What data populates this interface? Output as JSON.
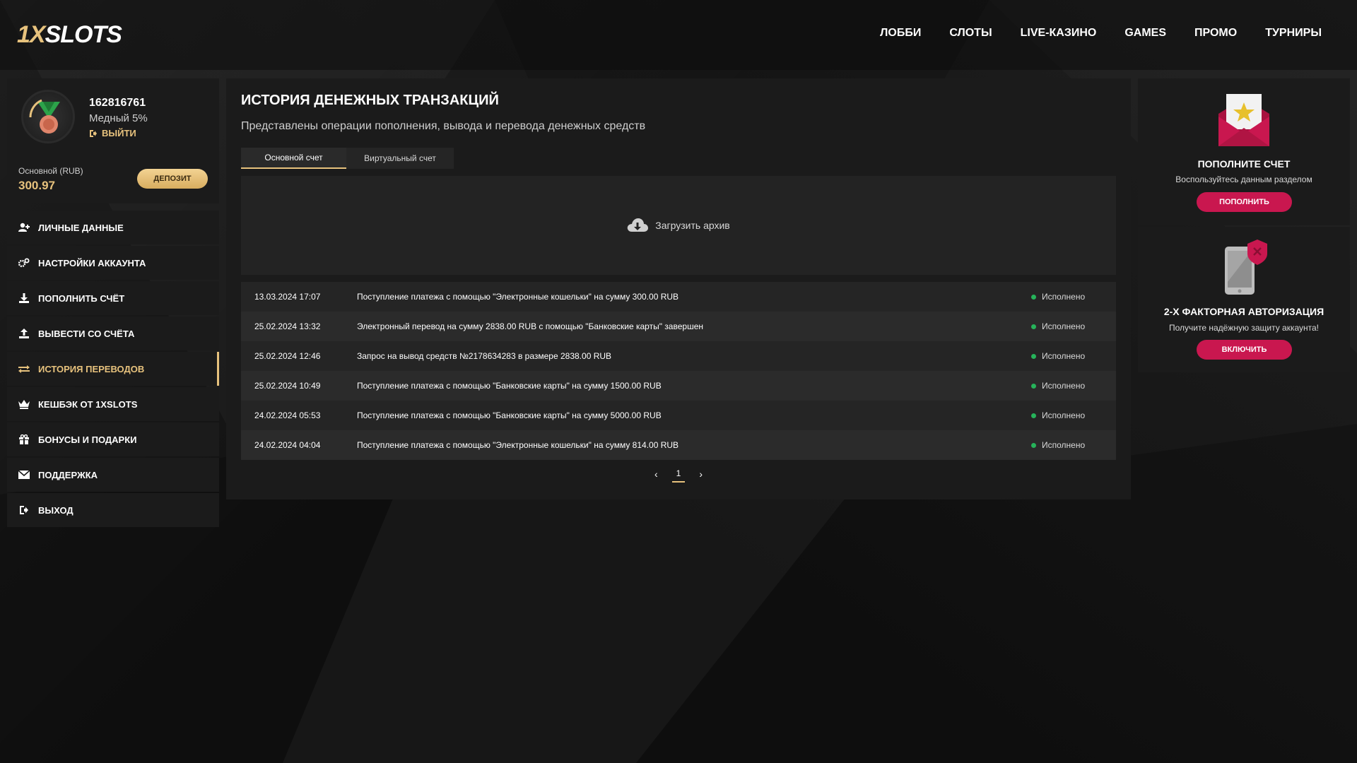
{
  "header": {
    "logo_one": "1X",
    "logo_rest": "SLOTS",
    "nav": [
      "ЛОББИ",
      "СЛОТЫ",
      "LIVE-КАЗИНО",
      "GAMES",
      "ПРОМО",
      "ТУРНИРЫ"
    ]
  },
  "user": {
    "id": "162816761",
    "level": "Медный 5%",
    "logout": "ВЫЙТИ",
    "account_label": "Основной (RUB)",
    "balance": "300.97",
    "deposit_label": "ДЕПОЗИТ"
  },
  "menu": [
    {
      "label": "ЛИЧНЫЕ ДАННЫЕ",
      "icon": "user-plus-icon"
    },
    {
      "label": "НАСТРОЙКИ АККАУНТА",
      "icon": "gears-icon"
    },
    {
      "label": "ПОПОЛНИТЬ СЧЁТ",
      "icon": "download-icon"
    },
    {
      "label": "ВЫВЕСТИ СО СЧЁТА",
      "icon": "upload-icon"
    },
    {
      "label": "ИСТОРИЯ ПЕРЕВОДОВ",
      "icon": "transfer-icon",
      "active": true
    },
    {
      "label": "КЕШБЭК ОТ 1XSLOTS",
      "icon": "crown-icon"
    },
    {
      "label": "БОНУСЫ И ПОДАРКИ",
      "icon": "gift-icon"
    },
    {
      "label": "ПОДДЕРЖКА",
      "icon": "envelope-icon"
    },
    {
      "label": "ВЫХОД",
      "icon": "logout-icon"
    }
  ],
  "main": {
    "title": "ИСТОРИЯ ДЕНЕЖНЫХ ТРАНЗАКЦИЙ",
    "subtitle": "Представлены операции пополнения, вывода и перевода денежных средств",
    "tabs": [
      "Основной счет",
      "Виртуальный счет"
    ],
    "archive_label": "Загрузить архив",
    "transactions": [
      {
        "date": "13.03.2024 17:07",
        "desc": "Поступление платежа с помощью \"Электронные кошельки\" на сумму 300.00 RUB",
        "status": "Исполнено"
      },
      {
        "date": "25.02.2024 13:32",
        "desc": "Электронный перевод на сумму 2838.00 RUB с помощью \"Банковские карты\" завершен",
        "status": "Исполнено"
      },
      {
        "date": "25.02.2024 12:46",
        "desc": "Запрос на вывод средств №2178634283 в размере 2838.00 RUB",
        "status": "Исполнено"
      },
      {
        "date": "25.02.2024 10:49",
        "desc": "Поступление платежа с помощью \"Банковские карты\" на сумму 1500.00 RUB",
        "status": "Исполнено"
      },
      {
        "date": "24.02.2024 05:53",
        "desc": "Поступление платежа с помощью \"Банковские карты\" на сумму 5000.00 RUB",
        "status": "Исполнено"
      },
      {
        "date": "24.02.2024 04:04",
        "desc": "Поступление платежа с помощью \"Электронные кошельки\" на сумму 814.00 RUB",
        "status": "Исполнено"
      }
    ],
    "pager": {
      "prev": "‹",
      "page": "1",
      "next": "›"
    }
  },
  "promos": [
    {
      "title": "ПОПОЛНИТЕ СЧЕТ",
      "text": "Воспользуйтесь данным разделом",
      "button": "ПОПОЛНИТЬ"
    },
    {
      "title": "2-Х ФАКТОРНАЯ АВТОРИЗАЦИЯ",
      "text": "Получите надёжную защиту аккаунта!",
      "button": "ВКЛЮЧИТЬ"
    }
  ],
  "colors": {
    "accent": "#e7c27d",
    "promo_button": "#c9174f",
    "status_ok": "#26b35a"
  }
}
